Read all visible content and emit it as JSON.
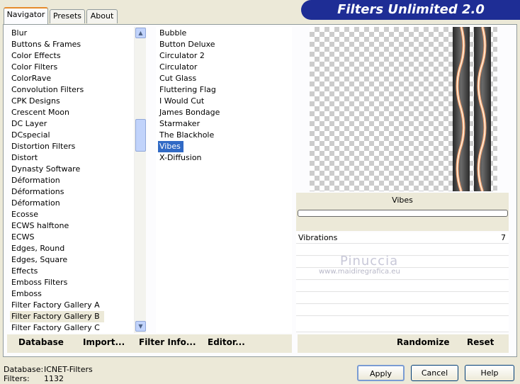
{
  "title": "Filters Unlimited 2.0",
  "tabs": [
    {
      "label": "Navigator"
    },
    {
      "label": "Presets"
    },
    {
      "label": "About"
    }
  ],
  "categories": [
    "Blur",
    "Buttons & Frames",
    "Color Effects",
    "Color Filters",
    "ColorRave",
    "Convolution Filters",
    "CPK Designs",
    "Crescent Moon",
    "DC Layer",
    "DCspecial",
    "Distortion Filters",
    "Distort",
    "Dynasty Software",
    "Déformation",
    "Déformations",
    "Déformation",
    "Ecosse",
    "ECWS halftone",
    "ECWS",
    "Edges, Round",
    "Edges, Square",
    "Effects",
    "Emboss Filters",
    "Emboss",
    "Filter Factory Gallery A",
    "Filter Factory Gallery B",
    "Filter Factory Gallery C"
  ],
  "highlighted_category": "Filter Factory Gallery B",
  "filters": [
    "Bubble",
    "Button Deluxe",
    "Circulator 2",
    "Circulator",
    "Cut Glass",
    "Fluttering Flag",
    "I Would Cut",
    "James Bondage",
    "Starmaker",
    "The Blackhole",
    "Vibes",
    "X-Diffusion"
  ],
  "selected_filter": "Vibes",
  "preview_name": "Vibes",
  "param": {
    "label": "Vibrations",
    "value": "7"
  },
  "watermark": {
    "name": "Pinuccia",
    "url": "www.maidiregrafica.eu"
  },
  "toolbar": {
    "database": "Database",
    "import": "Import...",
    "filter_info": "Filter Info...",
    "editor": "Editor...",
    "randomize": "Randomize",
    "reset": "Reset"
  },
  "status": {
    "database_label": "Database:",
    "database_value": "ICNET-Filters",
    "filters_label": "Filters:",
    "filters_value": "1132"
  },
  "buttons": {
    "apply": "Apply",
    "cancel": "Cancel",
    "help": "Help"
  },
  "colors": {
    "banner": "#1e2d95",
    "selection": "#316ac5",
    "tab_accent": "#e68b2c"
  }
}
